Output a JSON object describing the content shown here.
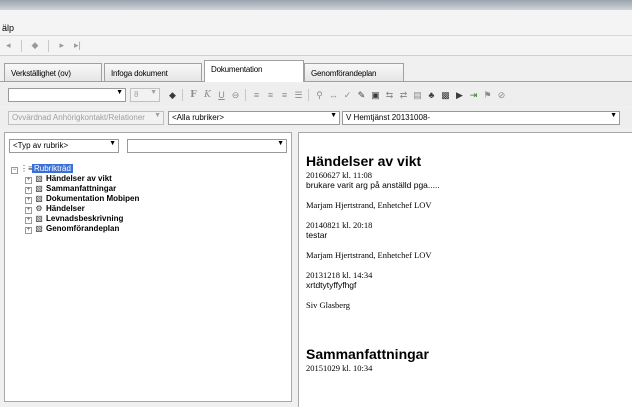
{
  "window": {
    "title": ""
  },
  "menu": {
    "label": "älp"
  },
  "nav": {
    "first": "◂",
    "diamond": "◆",
    "next": "▸",
    "last": "▸|"
  },
  "tabs": [
    {
      "label": "Verkställighet (ov)"
    },
    {
      "label": "Infoga dokument"
    },
    {
      "label": "Dokumentation"
    },
    {
      "label": "Genomförandeplan"
    }
  ],
  "toolbar": {
    "font_value": "",
    "size_value": "8",
    "bold": "F",
    "italic": "K",
    "underline": "U"
  },
  "filters": {
    "relation": "Ovvärdnad Anhörigkontakt/Relationer",
    "rubrik": "<Alla rubriker>",
    "insats": "V Hemtjänst 20131008-"
  },
  "left": {
    "type_combo": "<Typ av rubrik>",
    "second_combo": "",
    "tree": {
      "root": "Rubrikträd",
      "items": [
        {
          "label": "Händelser av vikt"
        },
        {
          "label": "Sammanfattningar"
        },
        {
          "label": "Dokumentation Mobipen"
        },
        {
          "label": "Händelser"
        },
        {
          "label": "Levnadsbeskrivning"
        },
        {
          "label": "Genomförandeplan"
        }
      ]
    }
  },
  "document": {
    "section1": {
      "heading": "Händelser av vikt",
      "entries": [
        {
          "date": "20160627 kl. 11:08",
          "text": "brukare varit arg på anställd pga.....",
          "author": "Marjam Hjertstrand, Enhetchef LOV"
        },
        {
          "date": "20140821 kl. 20:18",
          "text": "testar",
          "author": "Marjam Hjertstrand, Enhetchef LOV"
        },
        {
          "date": "20131218 kl. 14:34",
          "text": "xrtdtytyffyfhgf",
          "author": "Siv Glasberg"
        }
      ]
    },
    "section2": {
      "heading": "Sammanfattningar",
      "entries": [
        {
          "date": "20151029 kl. 10:34"
        }
      ]
    }
  }
}
